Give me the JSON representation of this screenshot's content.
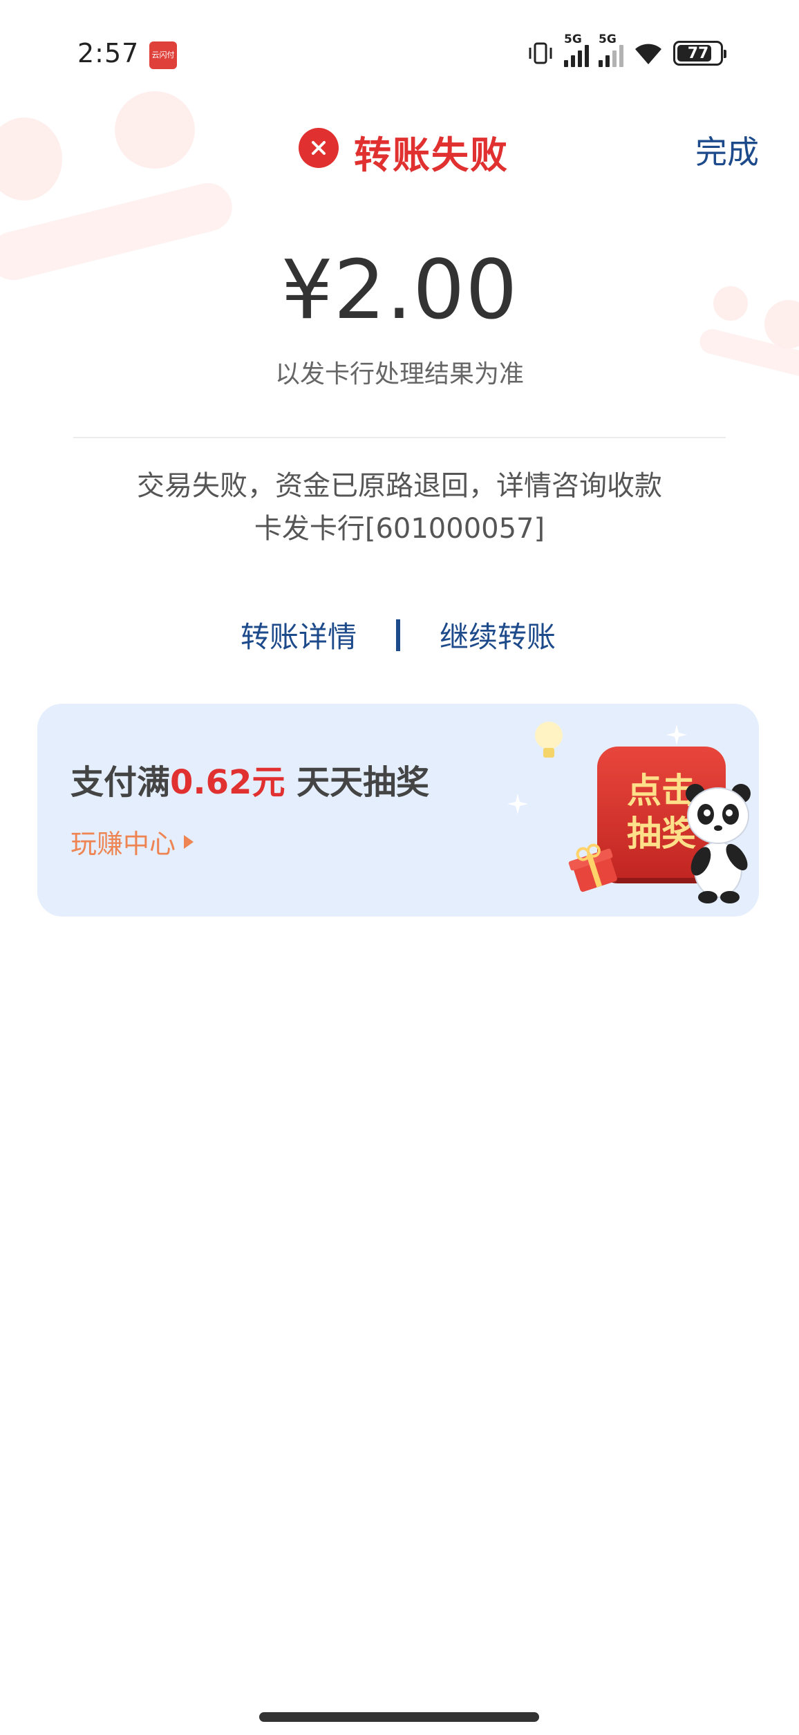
{
  "status_bar": {
    "time": "2:57",
    "app_badge": "云闪付",
    "network_1": "5G",
    "network_2": "5G",
    "battery": "77"
  },
  "header": {
    "title": "转账失败",
    "done_label": "完成"
  },
  "result": {
    "amount": "¥2.00",
    "note": "以发卡行处理结果为准",
    "message": "交易失败，资金已原路退回，详情咨询收款卡发卡行[601000057]"
  },
  "actions": {
    "details_label": "转账详情",
    "continue_label": "继续转账"
  },
  "promo": {
    "title_prefix": "支付满",
    "title_highlight": "0.62元",
    "title_suffix": " 天天抽奖",
    "link_label": "玩赚中心",
    "button_line1": "点击",
    "button_line2": "抽奖"
  },
  "colors": {
    "error_red": "#e13030",
    "link_blue": "#1d4a8a",
    "promo_bg": "#e4eefc",
    "promo_orange": "#ef8453"
  }
}
